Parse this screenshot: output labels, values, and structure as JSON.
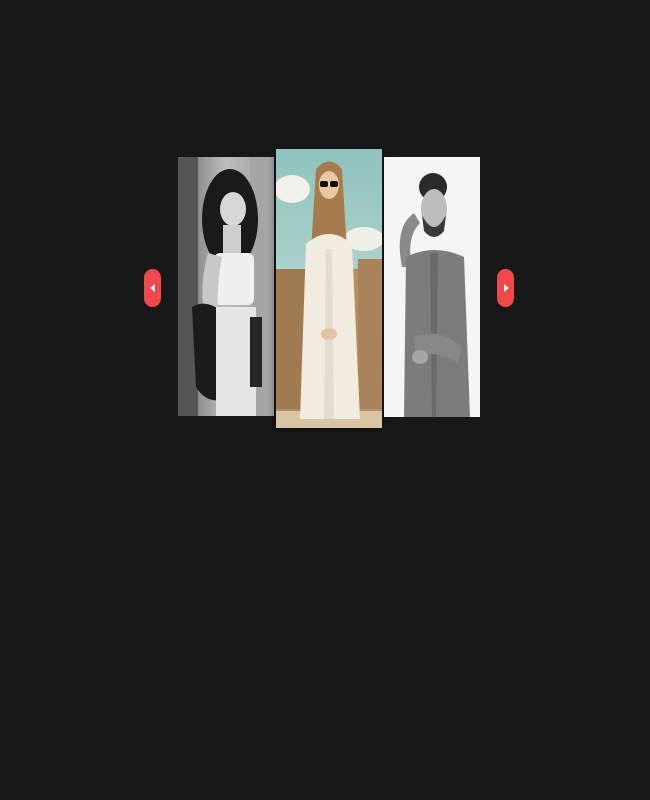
{
  "carousel": {
    "prev_button": {
      "icon": "chevron-left-icon"
    },
    "next_button": {
      "icon": "chevron-right-icon"
    },
    "slides": [
      {
        "subject": "woman-curly-hair-bw-photo",
        "state": "side"
      },
      {
        "subject": "woman-sunglasses-color-photo",
        "state": "active"
      },
      {
        "subject": "man-beard-bw-photo",
        "state": "side"
      }
    ]
  },
  "colors": {
    "background": "#181818",
    "accent": "#f0484b"
  }
}
